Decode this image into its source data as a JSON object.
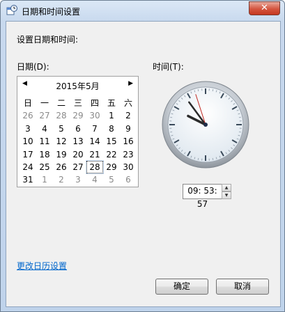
{
  "window": {
    "title": "日期和时间设置",
    "close_glyph": "✕"
  },
  "heading": "设置日期和时间:",
  "date_label": "日期(D):",
  "time_label": "时间(T):",
  "calendar": {
    "month_title": "2015年5月",
    "prev": "◀",
    "next": "▶",
    "weekdays": [
      "日",
      "一",
      "二",
      "三",
      "四",
      "五",
      "六"
    ],
    "weeks": [
      [
        "26",
        "27",
        "28",
        "29",
        "30",
        "1",
        "2"
      ],
      [
        "3",
        "4",
        "5",
        "6",
        "7",
        "8",
        "9"
      ],
      [
        "10",
        "11",
        "12",
        "13",
        "14",
        "15",
        "16"
      ],
      [
        "17",
        "18",
        "19",
        "20",
        "21",
        "22",
        "23"
      ],
      [
        "24",
        "25",
        "26",
        "27",
        "28",
        "29",
        "30"
      ],
      [
        "31",
        "1",
        "2",
        "3",
        "4",
        "5",
        "6"
      ]
    ],
    "selected_day": "28"
  },
  "clock": {
    "hours": 9,
    "minutes": 53,
    "seconds": 57
  },
  "time_value": "09: 53: 57",
  "link_text": "更改日历设置",
  "buttons": {
    "ok": "确定",
    "cancel": "取消"
  }
}
